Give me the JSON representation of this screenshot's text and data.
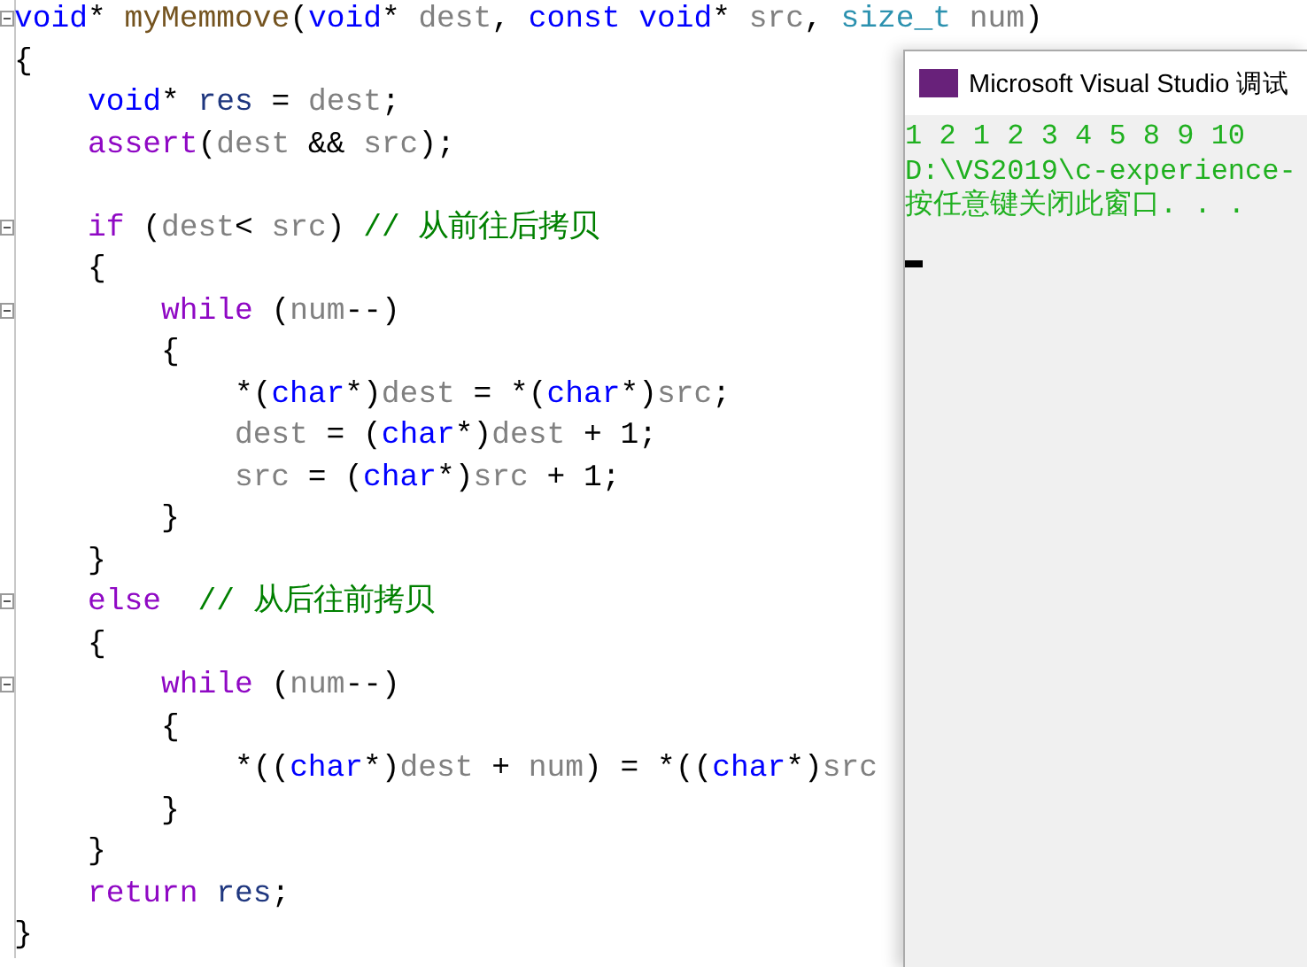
{
  "editor": {
    "lines": [
      {
        "fold": true,
        "tokens": [
          {
            "kind": "keyword",
            "text": "void"
          },
          {
            "kind": "plain",
            "text": "* "
          },
          {
            "kind": "function",
            "text": "myMemmove"
          },
          {
            "kind": "plain",
            "text": "("
          },
          {
            "kind": "keyword",
            "text": "void"
          },
          {
            "kind": "plain",
            "text": "* "
          },
          {
            "kind": "param",
            "text": "dest"
          },
          {
            "kind": "plain",
            "text": ", "
          },
          {
            "kind": "keyword",
            "text": "const "
          },
          {
            "kind": "keyword",
            "text": "void"
          },
          {
            "kind": "plain",
            "text": "* "
          },
          {
            "kind": "param",
            "text": "src"
          },
          {
            "kind": "plain",
            "text": ", "
          },
          {
            "kind": "type",
            "text": "size_t "
          },
          {
            "kind": "param",
            "text": "num"
          },
          {
            "kind": "plain",
            "text": ")"
          }
        ]
      },
      {
        "fold": false,
        "tokens": [
          {
            "kind": "plain",
            "text": "{"
          }
        ]
      },
      {
        "fold": false,
        "tokens": [
          {
            "kind": "keyword",
            "text": "    void"
          },
          {
            "kind": "plain",
            "text": "* "
          },
          {
            "kind": "local",
            "text": "res"
          },
          {
            "kind": "plain",
            "text": " = "
          },
          {
            "kind": "param",
            "text": "dest"
          },
          {
            "kind": "plain",
            "text": ";"
          }
        ]
      },
      {
        "fold": false,
        "tokens": [
          {
            "kind": "control",
            "text": "    assert"
          },
          {
            "kind": "plain",
            "text": "("
          },
          {
            "kind": "param",
            "text": "dest"
          },
          {
            "kind": "plain",
            "text": " && "
          },
          {
            "kind": "param",
            "text": "src"
          },
          {
            "kind": "plain",
            "text": ");"
          }
        ]
      },
      {
        "fold": false
      },
      {
        "fold": true,
        "tokens": [
          {
            "kind": "control",
            "text": "    if"
          },
          {
            "kind": "plain",
            "text": " ("
          },
          {
            "kind": "param",
            "text": "dest"
          },
          {
            "kind": "plain",
            "text": "< "
          },
          {
            "kind": "param",
            "text": "src"
          },
          {
            "kind": "plain",
            "text": ") "
          },
          {
            "kind": "comment",
            "text": "// 从前往后拷贝"
          }
        ]
      },
      {
        "fold": false,
        "tokens": [
          {
            "kind": "plain",
            "text": "    {"
          }
        ]
      },
      {
        "fold": true,
        "tokens": [
          {
            "kind": "control",
            "text": "        while"
          },
          {
            "kind": "plain",
            "text": " ("
          },
          {
            "kind": "param",
            "text": "num"
          },
          {
            "kind": "plain",
            "text": "--)"
          }
        ]
      },
      {
        "fold": false,
        "tokens": [
          {
            "kind": "plain",
            "text": "        {"
          }
        ]
      },
      {
        "fold": false,
        "tokens": [
          {
            "kind": "plain",
            "text": "            *("
          },
          {
            "kind": "keyword",
            "text": "char"
          },
          {
            "kind": "plain",
            "text": "*)"
          },
          {
            "kind": "param",
            "text": "dest"
          },
          {
            "kind": "plain",
            "text": " = *("
          },
          {
            "kind": "keyword",
            "text": "char"
          },
          {
            "kind": "plain",
            "text": "*)"
          },
          {
            "kind": "param",
            "text": "src"
          },
          {
            "kind": "plain",
            "text": ";"
          }
        ]
      },
      {
        "fold": false,
        "tokens": [
          {
            "kind": "param",
            "text": "            dest"
          },
          {
            "kind": "plain",
            "text": " = ("
          },
          {
            "kind": "keyword",
            "text": "char"
          },
          {
            "kind": "plain",
            "text": "*)"
          },
          {
            "kind": "param",
            "text": "dest"
          },
          {
            "kind": "plain",
            "text": " + 1;"
          }
        ]
      },
      {
        "fold": false,
        "tokens": [
          {
            "kind": "param",
            "text": "            src"
          },
          {
            "kind": "plain",
            "text": " = ("
          },
          {
            "kind": "keyword",
            "text": "char"
          },
          {
            "kind": "plain",
            "text": "*)"
          },
          {
            "kind": "param",
            "text": "src"
          },
          {
            "kind": "plain",
            "text": " + 1;"
          }
        ]
      },
      {
        "fold": false,
        "tokens": [
          {
            "kind": "plain",
            "text": "        }"
          }
        ]
      },
      {
        "fold": false,
        "tokens": [
          {
            "kind": "plain",
            "text": "    }"
          }
        ]
      },
      {
        "fold": true,
        "tokens": [
          {
            "kind": "control",
            "text": "    else  "
          },
          {
            "kind": "comment",
            "text": "// 从后往前拷贝"
          }
        ]
      },
      {
        "fold": false,
        "tokens": [
          {
            "kind": "plain",
            "text": "    {"
          }
        ]
      },
      {
        "fold": true,
        "tokens": [
          {
            "kind": "control",
            "text": "        while"
          },
          {
            "kind": "plain",
            "text": " ("
          },
          {
            "kind": "param",
            "text": "num"
          },
          {
            "kind": "plain",
            "text": "--)"
          }
        ]
      },
      {
        "fold": false,
        "tokens": [
          {
            "kind": "plain",
            "text": "        {"
          }
        ]
      },
      {
        "fold": false,
        "tokens": [
          {
            "kind": "plain",
            "text": "            *(("
          },
          {
            "kind": "keyword",
            "text": "char"
          },
          {
            "kind": "plain",
            "text": "*)"
          },
          {
            "kind": "param",
            "text": "dest"
          },
          {
            "kind": "plain",
            "text": " + "
          },
          {
            "kind": "param",
            "text": "num"
          },
          {
            "kind": "plain",
            "text": ") = *(("
          },
          {
            "kind": "keyword",
            "text": "char"
          },
          {
            "kind": "plain",
            "text": "*)"
          },
          {
            "kind": "param",
            "text": "src"
          }
        ]
      },
      {
        "fold": false,
        "tokens": [
          {
            "kind": "plain",
            "text": "        }"
          }
        ]
      },
      {
        "fold": false,
        "tokens": [
          {
            "kind": "plain",
            "text": "    }"
          }
        ]
      },
      {
        "fold": false,
        "tokens": [
          {
            "kind": "control",
            "text": "    return "
          },
          {
            "kind": "local",
            "text": "res"
          },
          {
            "kind": "plain",
            "text": ";"
          }
        ]
      },
      {
        "fold": false,
        "tokens": [
          {
            "kind": "plain",
            "text": "}"
          }
        ]
      }
    ]
  },
  "console": {
    "title": "Microsoft Visual Studio 调试",
    "output": [
      "1 2 1 2 3 4 5 8 9 10",
      "D:\\VS2019\\c-experience-",
      "按任意键关闭此窗口. . ."
    ]
  }
}
